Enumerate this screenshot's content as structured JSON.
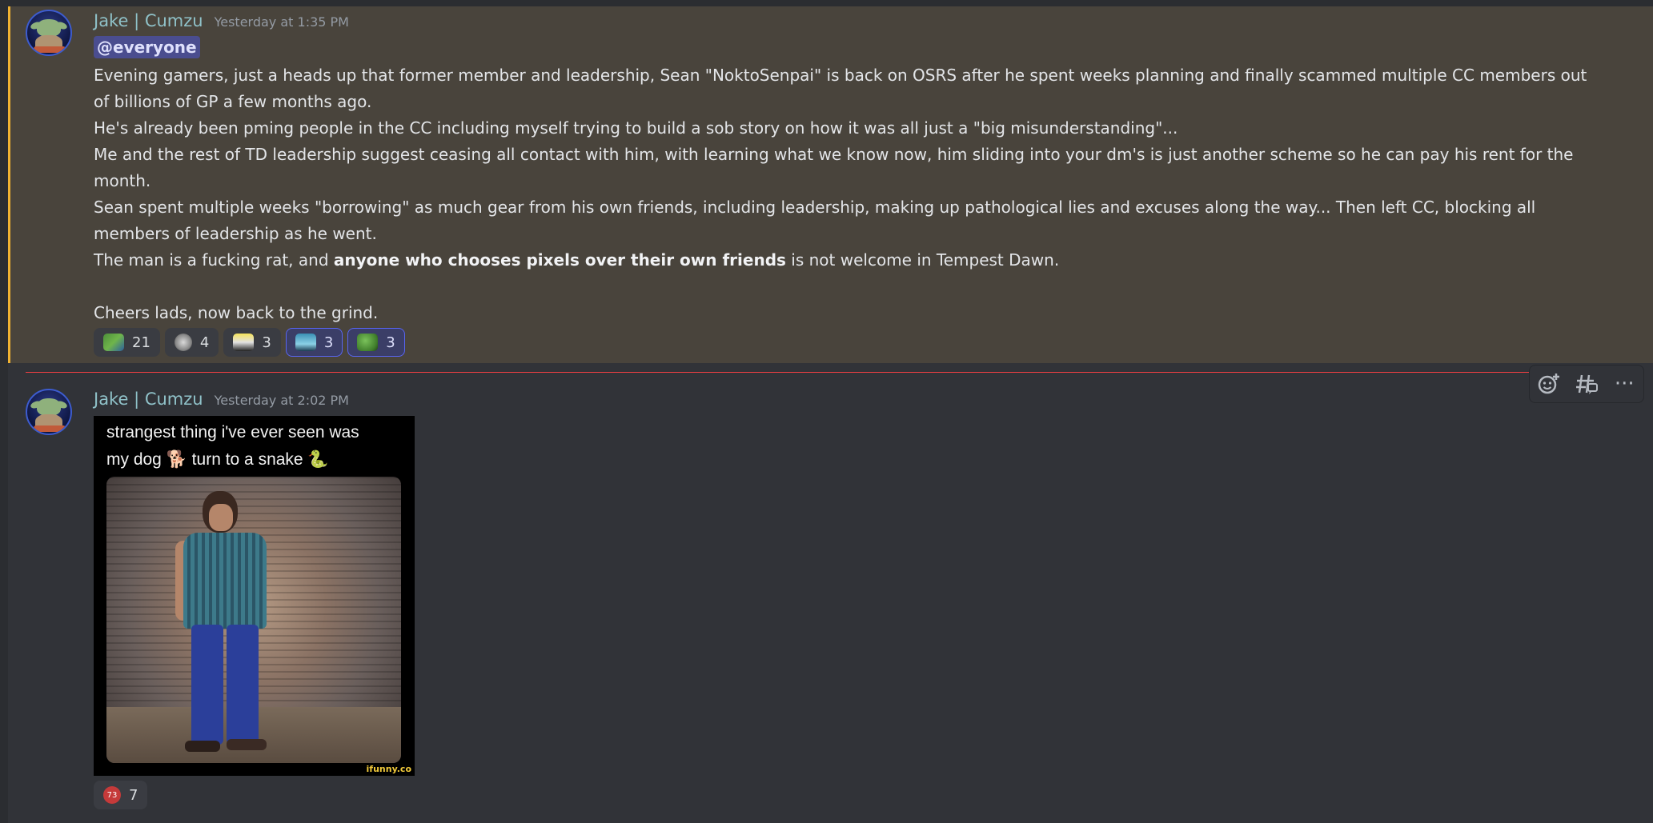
{
  "messages": [
    {
      "author": "Jake | Cumzu",
      "timestamp": "Yesterday at 1:35 PM",
      "mention": "@everyone",
      "lines": [
        "Evening gamers, just a heads up that former member and leadership, Sean \"NoktoSenpai\" is back on OSRS after he spent weeks planning and finally scammed multiple CC members out of billions of GP a few months ago.",
        "He's already been pming people in the CC including myself trying to build a sob story on how it was all just a \"big misunderstanding\"...",
        "Me and the rest of TD leadership suggest ceasing all contact with him, with learning what we know now, him sliding into your dm's is just another scheme so he can pay his rent for the month.",
        "Sean spent multiple weeks \"borrowing\" as much gear from his own friends, including leadership, making up pathological lies and excuses along the way... Then left CC, blocking all members of leadership as he went."
      ],
      "line5_pre": "The man is a fucking rat, and ",
      "line5_bold": "anyone who chooses pixels over their own friends",
      "line5_post": " is not welcome in Tempest Dawn.",
      "closing": "Cheers lads, now back to the grind.",
      "reactions": [
        {
          "icon": "frog-car-emoji",
          "count": "21",
          "active": false
        },
        {
          "icon": "cat-face-emoji",
          "count": "4",
          "active": false
        },
        {
          "icon": "kart-emoji",
          "count": "3",
          "active": false
        },
        {
          "icon": "race-car-emoji",
          "count": "3",
          "active": true
        },
        {
          "icon": "pepe-emoji",
          "count": "3",
          "active": true
        }
      ]
    },
    {
      "author": "Jake | Cumzu",
      "timestamp": "Yesterday at 2:02 PM",
      "image_caption_line1": "strangest thing i've ever seen was",
      "image_caption_line2": "my dog 🐕 turn to a snake 🐍",
      "image_watermark": "ifunny.co",
      "reactions": [
        {
          "icon": "73-badge-emoji",
          "badge_text": "73",
          "count": "7",
          "active": false
        }
      ]
    }
  ],
  "toolbar": {
    "add_reaction_icon": "add-reaction-icon",
    "create_thread_icon": "thread-icon",
    "more_icon": "more-options-icon",
    "more_glyph": "···"
  },
  "colors": {
    "highlight_bg": "#49443c",
    "highlight_border": "#f0b232",
    "username": "#8fc1c8",
    "new_divider": "#f23f43",
    "active_reaction_border": "#5865f2"
  }
}
